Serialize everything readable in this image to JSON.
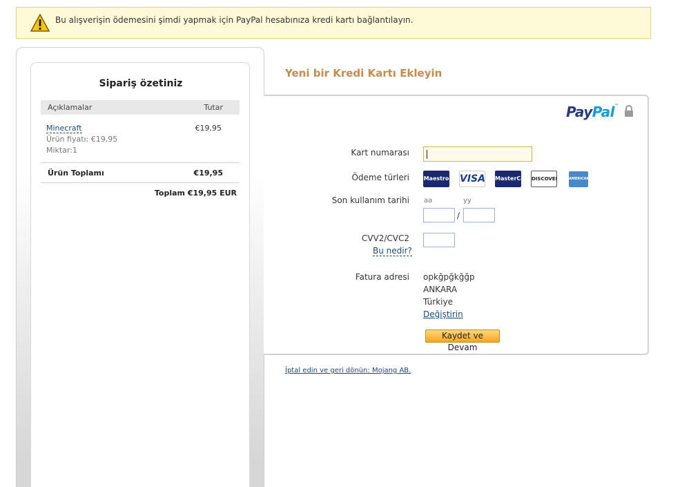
{
  "warning": {
    "icon": "warning-icon",
    "text": "Bu alışverişin ödemesini şimdi yapmak için PayPal hesabınıza kredi kartı bağlantılayın."
  },
  "order_summary": {
    "title": "Sipariş özetiniz",
    "col_description": "Açıklamalar",
    "col_amount": "Tutar",
    "item": {
      "name": "Minecraft",
      "price": "€19,95",
      "unit_price": "Ürün fiyatı: €19,95",
      "quantity": "Miktar:1"
    },
    "subtotal_label": "Ürün Toplamı",
    "subtotal_value": "€19,95",
    "total": "Toplam €19,95 EUR"
  },
  "card_form": {
    "section_title": "Yeni bir Kredi Kartı Ekleyin",
    "brand": {
      "part1": "Pay",
      "part2": "Pal",
      "tm": "™"
    },
    "card_number_label": "Kart numarası",
    "card_number_value": "",
    "payment_types_label": "Ödeme türleri",
    "card_types": [
      "Maestro",
      "VISA",
      "MasterCard",
      "DISCOVER",
      "AMERICAN EXPRESS"
    ],
    "expiry_label": "Son kullanım tarihi",
    "expiry_month_label": "aa",
    "expiry_year_label": "yy",
    "expiry_separator": "/",
    "cvv_label": "CVV2/CVC2",
    "cvv_help_link": "Bu nedir?",
    "billing_label": "Fatura adresi",
    "billing_address": [
      "opkğpğkğğp",
      "ANKARA",
      "Türkiye"
    ],
    "change_link": "Değiştirin",
    "save_button": "Kaydet ve Devam"
  },
  "cancel_link": "İptal edin ve geri dönün: Mojang AB."
}
